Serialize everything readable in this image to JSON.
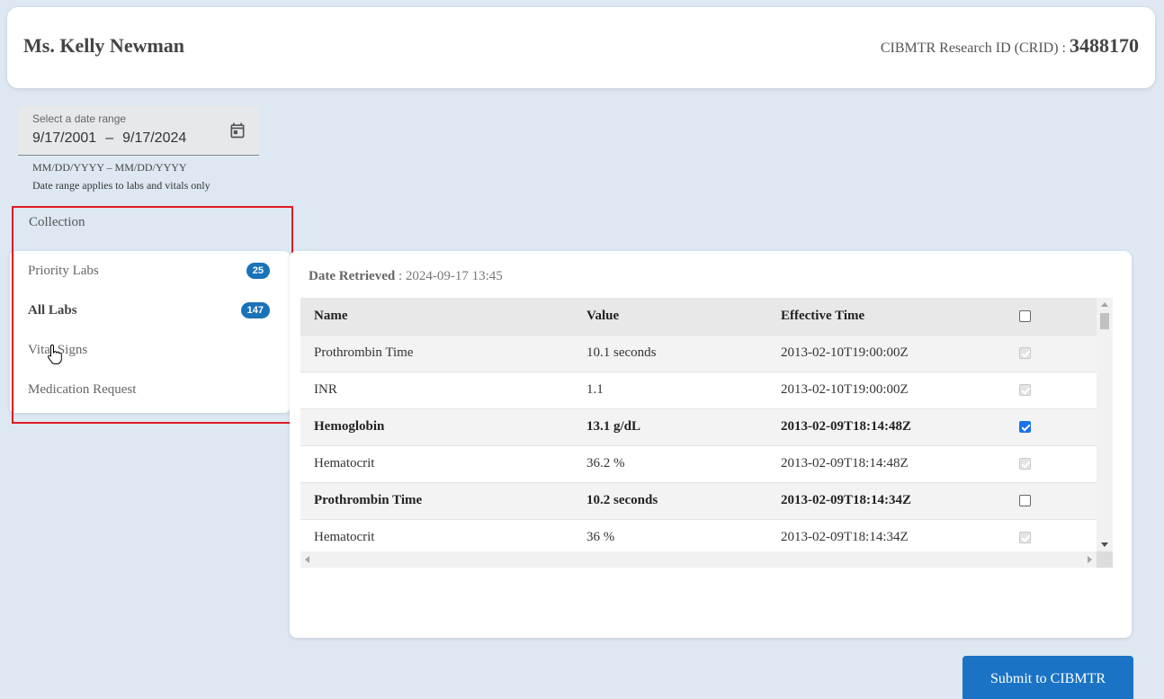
{
  "header": {
    "patient_name": "Ms. Kelly Newman",
    "crid_label": "CIBMTR Research ID (CRID) :",
    "crid_value": "3488170"
  },
  "date_range": {
    "label": "Select a date range",
    "start": "9/17/2001",
    "separator": "–",
    "end": "9/17/2024",
    "format_hint": "MM/DD/YYYY – MM/DD/YYYY",
    "note": "Date range applies to labs and vitals only",
    "icon": "calendar-icon"
  },
  "collection": {
    "label": "Collection",
    "items": [
      {
        "label": "Priority Labs",
        "badge": "25",
        "active": false
      },
      {
        "label": "All Labs",
        "badge": "147",
        "active": true
      },
      {
        "label": "Vital Signs",
        "badge": "",
        "active": false
      },
      {
        "label": "Medication Request",
        "badge": "",
        "active": false
      }
    ]
  },
  "data_panel": {
    "retrieved_label": "Date Retrieved",
    "retrieved_value": " : 2024-09-17 13:45",
    "columns": [
      "Name",
      "Value",
      "Effective Time"
    ],
    "rows": [
      {
        "name": "Prothrombin Time",
        "value": "10.1 seconds",
        "time": "2013-02-10T19:00:00Z",
        "checkbox": "disabled",
        "bold": false
      },
      {
        "name": "INR",
        "value": "1.1",
        "time": "2013-02-10T19:00:00Z",
        "checkbox": "disabled",
        "bold": false
      },
      {
        "name": "Hemoglobin",
        "value": "13.1 g/dL",
        "time": "2013-02-09T18:14:48Z",
        "checkbox": "checked",
        "bold": true
      },
      {
        "name": "Hematocrit",
        "value": "36.2 %",
        "time": "2013-02-09T18:14:48Z",
        "checkbox": "disabled",
        "bold": false
      },
      {
        "name": "Prothrombin Time",
        "value": "10.2 seconds",
        "time": "2013-02-09T18:14:34Z",
        "checkbox": "unchecked",
        "bold": true
      },
      {
        "name": "Hematocrit",
        "value": "36 %",
        "time": "2013-02-09T18:14:34Z",
        "checkbox": "disabled",
        "bold": false
      }
    ]
  },
  "actions": {
    "submit_label": "Submit to CIBMTR"
  }
}
